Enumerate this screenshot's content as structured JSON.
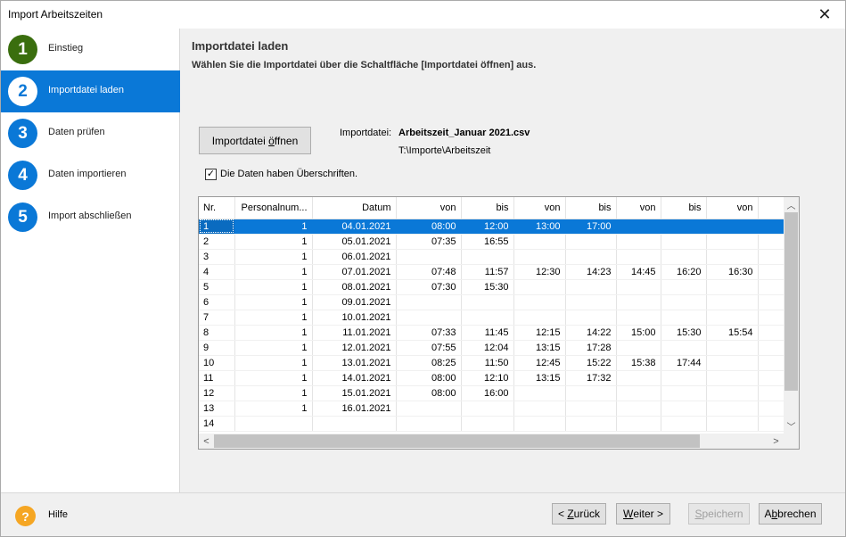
{
  "window": {
    "title": "Import Arbeitszeiten"
  },
  "sidebar": {
    "steps": [
      {
        "number": "1",
        "label": "Einstieg",
        "color": "#3a6e0e"
      },
      {
        "number": "2",
        "label": "Importdatei laden",
        "color": "#0a78d7"
      },
      {
        "number": "3",
        "label": "Daten prüfen",
        "color": "#0a78d7"
      },
      {
        "number": "4",
        "label": "Daten importieren",
        "color": "#0a78d7"
      },
      {
        "number": "5",
        "label": "Import abschließen",
        "color": "#0a78d7"
      }
    ]
  },
  "main": {
    "heading": "Importdatei laden",
    "instruction": "Wählen Sie die Importdatei über die Schaltfläche [Importdatei öffnen] aus.",
    "open_button": {
      "pre": "Importdatei ",
      "accel": "ö",
      "post": "ffnen"
    },
    "file_label": "Importdatei:",
    "file_name": "Arbeitszeit_Januar 2021.csv",
    "file_path": "T:\\Importe\\Arbeitszeit",
    "headers_checkbox": {
      "label": "Die Daten haben Überschriften.",
      "checked": true
    }
  },
  "grid": {
    "columns": [
      "Nr.",
      "Personalnum...",
      "Datum",
      "von",
      "bis",
      "von",
      "bis",
      "von",
      "bis",
      "von"
    ],
    "selected_row": 0,
    "rows": [
      [
        "1",
        "1",
        "04.01.2021",
        "08:00",
        "12:00",
        "13:00",
        "17:00",
        "",
        "",
        ""
      ],
      [
        "2",
        "1",
        "05.01.2021",
        "07:35",
        "16:55",
        "",
        "",
        "",
        "",
        ""
      ],
      [
        "3",
        "1",
        "06.01.2021",
        "",
        "",
        "",
        "",
        "",
        "",
        ""
      ],
      [
        "4",
        "1",
        "07.01.2021",
        "07:48",
        "11:57",
        "12:30",
        "14:23",
        "14:45",
        "16:20",
        "16:30"
      ],
      [
        "5",
        "1",
        "08.01.2021",
        "07:30",
        "15:30",
        "",
        "",
        "",
        "",
        ""
      ],
      [
        "6",
        "1",
        "09.01.2021",
        "",
        "",
        "",
        "",
        "",
        "",
        ""
      ],
      [
        "7",
        "1",
        "10.01.2021",
        "",
        "",
        "",
        "",
        "",
        "",
        ""
      ],
      [
        "8",
        "1",
        "11.01.2021",
        "07:33",
        "11:45",
        "12:15",
        "14:22",
        "15:00",
        "15:30",
        "15:54"
      ],
      [
        "9",
        "1",
        "12.01.2021",
        "07:55",
        "12:04",
        "13:15",
        "17:28",
        "",
        "",
        ""
      ],
      [
        "10",
        "1",
        "13.01.2021",
        "08:25",
        "11:50",
        "12:45",
        "15:22",
        "15:38",
        "17:44",
        ""
      ],
      [
        "11",
        "1",
        "14.01.2021",
        "08:00",
        "12:10",
        "13:15",
        "17:32",
        "",
        "",
        ""
      ],
      [
        "12",
        "1",
        "15.01.2021",
        "08:00",
        "16:00",
        "",
        "",
        "",
        "",
        ""
      ],
      [
        "13",
        "1",
        "16.01.2021",
        "",
        "",
        "",
        "",
        "",
        "",
        ""
      ],
      [
        "14",
        "",
        "",
        "",
        "",
        "",
        "",
        "",
        "",
        ""
      ]
    ]
  },
  "footer": {
    "help": "Hilfe",
    "back": {
      "pre": "< ",
      "accel": "Z",
      "post": "urück"
    },
    "next": {
      "pre": "",
      "accel": "W",
      "post": "eiter >"
    },
    "save": {
      "pre": "",
      "accel": "S",
      "post": "peichern"
    },
    "cancel": {
      "pre": "A",
      "accel": "b",
      "post": "brechen"
    }
  },
  "icons": {
    "close": "close-icon",
    "help": "help-icon",
    "check": "checkmark-icon",
    "scroll_up": "chevron-up-icon",
    "scroll_down": "chevron-down-icon",
    "scroll_left": "chevron-left-icon",
    "scroll_right": "chevron-right-icon"
  }
}
